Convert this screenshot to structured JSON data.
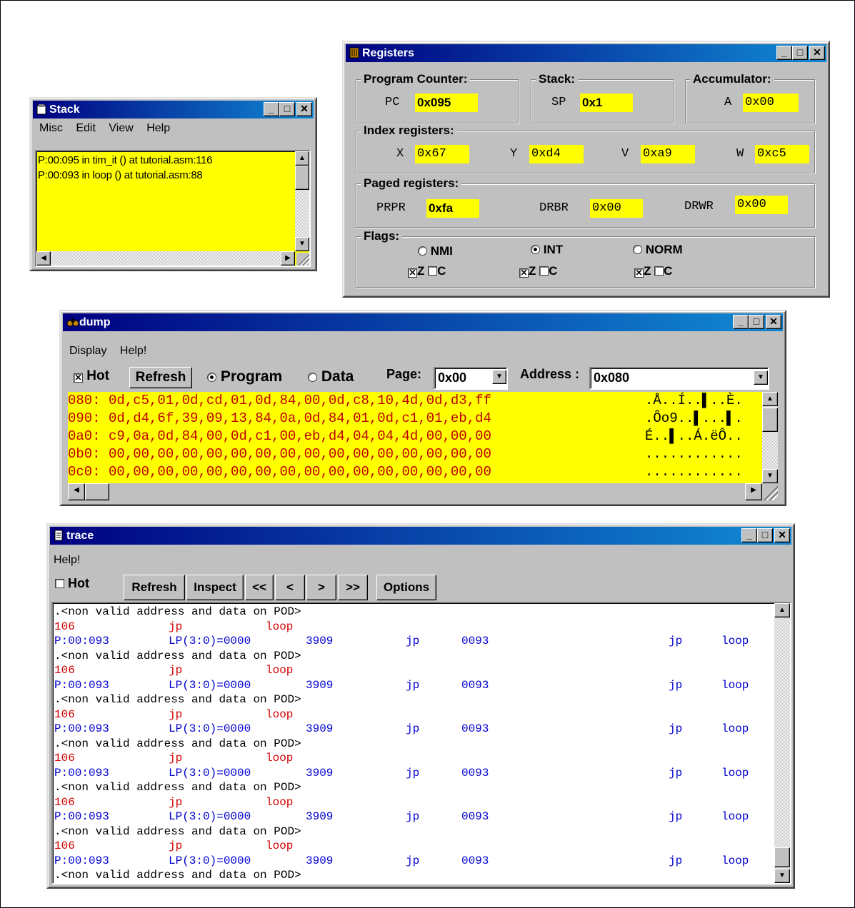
{
  "stack": {
    "title": "Stack",
    "menu": [
      "Misc",
      "Edit",
      "View",
      "Help"
    ],
    "entries": [
      "P:00:095  in tim_it () at tutorial.asm:116",
      "P:00:093  in loop () at tutorial.asm:88"
    ]
  },
  "registers": {
    "title": "Registers",
    "program_counter": {
      "group": "Program Counter:",
      "label": "PC",
      "value": "0x095"
    },
    "stack": {
      "group": "Stack:",
      "label": "SP",
      "value": "0x1"
    },
    "accumulator": {
      "group": "Accumulator:",
      "label": "A",
      "value": "0x00"
    },
    "index": {
      "group": "Index registers:",
      "X": "0x67",
      "Y": "0xd4",
      "V": "0xa9",
      "W": "0xc5",
      "labels": {
        "x": "X",
        "y": "Y",
        "v": "V",
        "w": "W"
      }
    },
    "paged": {
      "group": "Paged registers:",
      "prpr_label": "PRPR",
      "prpr": "0xfa",
      "drbr_label": "DRBR",
      "drbr": "0x00",
      "drwr_label": "DRWR",
      "drwr": "0x00"
    },
    "flags": {
      "group": "Flags:",
      "modes": [
        "NMI",
        "INT",
        "NORM"
      ],
      "selected": "INT",
      "z_label": "Z",
      "c_label": "C"
    }
  },
  "dump": {
    "title": "dump",
    "menu": [
      "Display",
      "Help!"
    ],
    "hot_label": "Hot",
    "refresh_label": "Refresh",
    "program_label": "Program",
    "data_label": "Data",
    "page_label": "Page:",
    "page_value": "0x00",
    "address_label": "Address :",
    "address_value": "0x080",
    "rows": [
      {
        "addr": "080:",
        "hex": "0d,c5,01,0d,cd,01,0d,84,00,0d,c8,10,4d,0d,d3,ff",
        "ascii": ".Å..Í..▌..È."
      },
      {
        "addr": "090:",
        "hex": "0d,d4,6f,39,09,13,84,0a,0d,84,01,0d,c1,01,eb,d4",
        "ascii": ".Ôo9..▌...▌."
      },
      {
        "addr": "0a0:",
        "hex": "c9,0a,0d,84,00,0d,c1,00,eb,d4,04,04,4d,00,00,00",
        "ascii": "É..▌..Á.ëÔ.."
      },
      {
        "addr": "0b0:",
        "hex": "00,00,00,00,00,00,00,00,00,00,00,00,00,00,00,00",
        "ascii": "............"
      },
      {
        "addr": "0c0:",
        "hex": "00,00,00,00,00,00,00,00,00,00,00,00,00,00,00,00",
        "ascii": "............"
      }
    ]
  },
  "trace": {
    "title": "trace",
    "menu": [
      "Help!"
    ],
    "hot_label": "Hot",
    "buttons": [
      "Refresh",
      "Inspect",
      "<<",
      "<",
      ">",
      ">>",
      "Options"
    ],
    "invalid_text": ".<non valid address and data on POD>",
    "cycle": {
      "num": "106",
      "op": "jp",
      "arg": "loop"
    },
    "pc_row": {
      "pc": "P:00:093",
      "lp": "LP(3:0)=0000",
      "code": "3909",
      "op": "jp",
      "addr": "0093",
      "op2": "jp",
      "sym": "loop"
    }
  }
}
